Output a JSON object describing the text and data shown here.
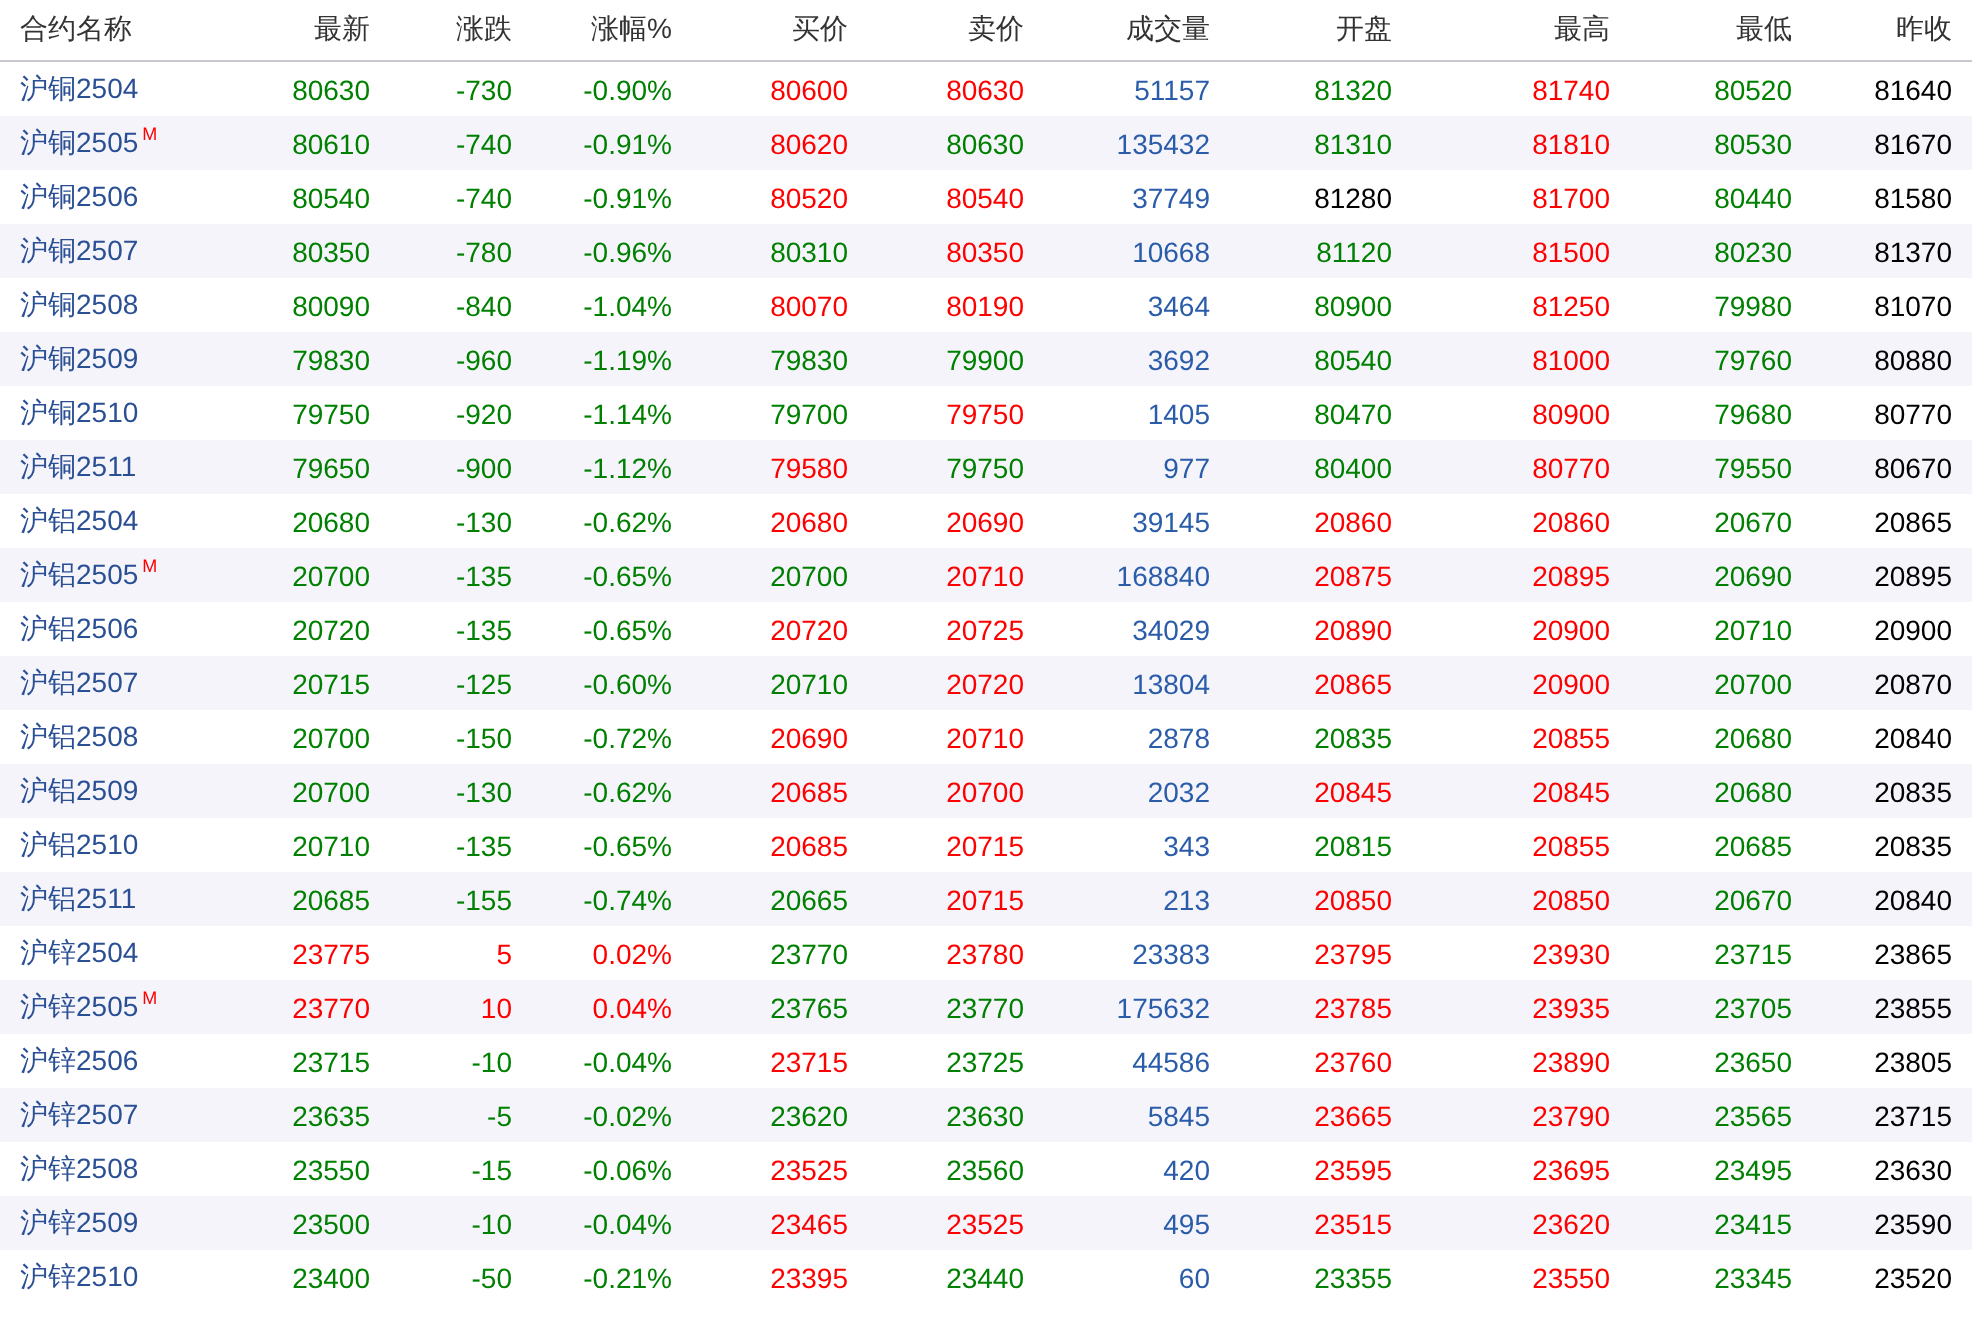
{
  "table": {
    "columns": [
      "合约名称",
      "最新",
      "涨跌",
      "涨幅%",
      "买价",
      "卖价",
      "成交量",
      "开盘",
      "最高",
      "最低",
      "昨收"
    ],
    "rows": [
      {
        "cells": [
          {
            "text": "沪铜2504"
          },
          {
            "text": "80630",
            "color": "#008000"
          },
          {
            "text": "-730",
            "color": "#008000"
          },
          {
            "text": "-0.90%",
            "color": "#008000"
          },
          {
            "text": "80600",
            "color": "#ff0000"
          },
          {
            "text": "80630",
            "color": "#ff0000"
          },
          {
            "text": "51157",
            "color": "#2a5caa"
          },
          {
            "text": "81320",
            "color": "#008000"
          },
          {
            "text": "81740",
            "color": "#ff0000"
          },
          {
            "text": "80520",
            "color": "#008000"
          },
          {
            "text": "81640",
            "color": "#000000"
          }
        ]
      },
      {
        "cells": [
          {
            "text": "沪铜2505",
            "badge": "M"
          },
          {
            "text": "80610",
            "color": "#008000"
          },
          {
            "text": "-740",
            "color": "#008000"
          },
          {
            "text": "-0.91%",
            "color": "#008000"
          },
          {
            "text": "80620",
            "color": "#ff0000"
          },
          {
            "text": "80630",
            "color": "#008000"
          },
          {
            "text": "135432",
            "color": "#2a5caa"
          },
          {
            "text": "81310",
            "color": "#008000"
          },
          {
            "text": "81810",
            "color": "#ff0000"
          },
          {
            "text": "80530",
            "color": "#008000"
          },
          {
            "text": "81670",
            "color": "#000000"
          }
        ]
      },
      {
        "cells": [
          {
            "text": "沪铜2506"
          },
          {
            "text": "80540",
            "color": "#008000"
          },
          {
            "text": "-740",
            "color": "#008000"
          },
          {
            "text": "-0.91%",
            "color": "#008000"
          },
          {
            "text": "80520",
            "color": "#ff0000"
          },
          {
            "text": "80540",
            "color": "#ff0000"
          },
          {
            "text": "37749",
            "color": "#2a5caa"
          },
          {
            "text": "81280",
            "color": "#000000"
          },
          {
            "text": "81700",
            "color": "#ff0000"
          },
          {
            "text": "80440",
            "color": "#008000"
          },
          {
            "text": "81580",
            "color": "#000000"
          }
        ]
      },
      {
        "cells": [
          {
            "text": "沪铜2507"
          },
          {
            "text": "80350",
            "color": "#008000"
          },
          {
            "text": "-780",
            "color": "#008000"
          },
          {
            "text": "-0.96%",
            "color": "#008000"
          },
          {
            "text": "80310",
            "color": "#008000"
          },
          {
            "text": "80350",
            "color": "#ff0000"
          },
          {
            "text": "10668",
            "color": "#2a5caa"
          },
          {
            "text": "81120",
            "color": "#008000"
          },
          {
            "text": "81500",
            "color": "#ff0000"
          },
          {
            "text": "80230",
            "color": "#008000"
          },
          {
            "text": "81370",
            "color": "#000000"
          }
        ]
      },
      {
        "cells": [
          {
            "text": "沪铜2508"
          },
          {
            "text": "80090",
            "color": "#008000"
          },
          {
            "text": "-840",
            "color": "#008000"
          },
          {
            "text": "-1.04%",
            "color": "#008000"
          },
          {
            "text": "80070",
            "color": "#ff0000"
          },
          {
            "text": "80190",
            "color": "#ff0000"
          },
          {
            "text": "3464",
            "color": "#2a5caa"
          },
          {
            "text": "80900",
            "color": "#008000"
          },
          {
            "text": "81250",
            "color": "#ff0000"
          },
          {
            "text": "79980",
            "color": "#008000"
          },
          {
            "text": "81070",
            "color": "#000000"
          }
        ]
      },
      {
        "cells": [
          {
            "text": "沪铜2509"
          },
          {
            "text": "79830",
            "color": "#008000"
          },
          {
            "text": "-960",
            "color": "#008000"
          },
          {
            "text": "-1.19%",
            "color": "#008000"
          },
          {
            "text": "79830",
            "color": "#008000"
          },
          {
            "text": "79900",
            "color": "#008000"
          },
          {
            "text": "3692",
            "color": "#2a5caa"
          },
          {
            "text": "80540",
            "color": "#008000"
          },
          {
            "text": "81000",
            "color": "#ff0000"
          },
          {
            "text": "79760",
            "color": "#008000"
          },
          {
            "text": "80880",
            "color": "#000000"
          }
        ]
      },
      {
        "cells": [
          {
            "text": "沪铜2510"
          },
          {
            "text": "79750",
            "color": "#008000"
          },
          {
            "text": "-920",
            "color": "#008000"
          },
          {
            "text": "-1.14%",
            "color": "#008000"
          },
          {
            "text": "79700",
            "color": "#008000"
          },
          {
            "text": "79750",
            "color": "#ff0000"
          },
          {
            "text": "1405",
            "color": "#2a5caa"
          },
          {
            "text": "80470",
            "color": "#008000"
          },
          {
            "text": "80900",
            "color": "#ff0000"
          },
          {
            "text": "79680",
            "color": "#008000"
          },
          {
            "text": "80770",
            "color": "#000000"
          }
        ]
      },
      {
        "cells": [
          {
            "text": "沪铜2511"
          },
          {
            "text": "79650",
            "color": "#008000"
          },
          {
            "text": "-900",
            "color": "#008000"
          },
          {
            "text": "-1.12%",
            "color": "#008000"
          },
          {
            "text": "79580",
            "color": "#ff0000"
          },
          {
            "text": "79750",
            "color": "#008000"
          },
          {
            "text": "977",
            "color": "#2a5caa"
          },
          {
            "text": "80400",
            "color": "#008000"
          },
          {
            "text": "80770",
            "color": "#ff0000"
          },
          {
            "text": "79550",
            "color": "#008000"
          },
          {
            "text": "80670",
            "color": "#000000"
          }
        ]
      },
      {
        "cells": [
          {
            "text": "沪铝2504"
          },
          {
            "text": "20680",
            "color": "#008000"
          },
          {
            "text": "-130",
            "color": "#008000"
          },
          {
            "text": "-0.62%",
            "color": "#008000"
          },
          {
            "text": "20680",
            "color": "#ff0000"
          },
          {
            "text": "20690",
            "color": "#ff0000"
          },
          {
            "text": "39145",
            "color": "#2a5caa"
          },
          {
            "text": "20860",
            "color": "#ff0000"
          },
          {
            "text": "20860",
            "color": "#ff0000"
          },
          {
            "text": "20670",
            "color": "#008000"
          },
          {
            "text": "20865",
            "color": "#000000"
          }
        ]
      },
      {
        "cells": [
          {
            "text": "沪铝2505",
            "badge": "M"
          },
          {
            "text": "20700",
            "color": "#008000"
          },
          {
            "text": "-135",
            "color": "#008000"
          },
          {
            "text": "-0.65%",
            "color": "#008000"
          },
          {
            "text": "20700",
            "color": "#008000"
          },
          {
            "text": "20710",
            "color": "#ff0000"
          },
          {
            "text": "168840",
            "color": "#2a5caa"
          },
          {
            "text": "20875",
            "color": "#ff0000"
          },
          {
            "text": "20895",
            "color": "#ff0000"
          },
          {
            "text": "20690",
            "color": "#008000"
          },
          {
            "text": "20895",
            "color": "#000000"
          }
        ]
      },
      {
        "cells": [
          {
            "text": "沪铝2506"
          },
          {
            "text": "20720",
            "color": "#008000"
          },
          {
            "text": "-135",
            "color": "#008000"
          },
          {
            "text": "-0.65%",
            "color": "#008000"
          },
          {
            "text": "20720",
            "color": "#ff0000"
          },
          {
            "text": "20725",
            "color": "#ff0000"
          },
          {
            "text": "34029",
            "color": "#2a5caa"
          },
          {
            "text": "20890",
            "color": "#ff0000"
          },
          {
            "text": "20900",
            "color": "#ff0000"
          },
          {
            "text": "20710",
            "color": "#008000"
          },
          {
            "text": "20900",
            "color": "#000000"
          }
        ]
      },
      {
        "cells": [
          {
            "text": "沪铝2507"
          },
          {
            "text": "20715",
            "color": "#008000"
          },
          {
            "text": "-125",
            "color": "#008000"
          },
          {
            "text": "-0.60%",
            "color": "#008000"
          },
          {
            "text": "20710",
            "color": "#008000"
          },
          {
            "text": "20720",
            "color": "#ff0000"
          },
          {
            "text": "13804",
            "color": "#2a5caa"
          },
          {
            "text": "20865",
            "color": "#ff0000"
          },
          {
            "text": "20900",
            "color": "#ff0000"
          },
          {
            "text": "20700",
            "color": "#008000"
          },
          {
            "text": "20870",
            "color": "#000000"
          }
        ]
      },
      {
        "cells": [
          {
            "text": "沪铝2508"
          },
          {
            "text": "20700",
            "color": "#008000"
          },
          {
            "text": "-150",
            "color": "#008000"
          },
          {
            "text": "-0.72%",
            "color": "#008000"
          },
          {
            "text": "20690",
            "color": "#ff0000"
          },
          {
            "text": "20710",
            "color": "#ff0000"
          },
          {
            "text": "2878",
            "color": "#2a5caa"
          },
          {
            "text": "20835",
            "color": "#008000"
          },
          {
            "text": "20855",
            "color": "#ff0000"
          },
          {
            "text": "20680",
            "color": "#008000"
          },
          {
            "text": "20840",
            "color": "#000000"
          }
        ]
      },
      {
        "cells": [
          {
            "text": "沪铝2509"
          },
          {
            "text": "20700",
            "color": "#008000"
          },
          {
            "text": "-130",
            "color": "#008000"
          },
          {
            "text": "-0.62%",
            "color": "#008000"
          },
          {
            "text": "20685",
            "color": "#ff0000"
          },
          {
            "text": "20700",
            "color": "#ff0000"
          },
          {
            "text": "2032",
            "color": "#2a5caa"
          },
          {
            "text": "20845",
            "color": "#ff0000"
          },
          {
            "text": "20845",
            "color": "#ff0000"
          },
          {
            "text": "20680",
            "color": "#008000"
          },
          {
            "text": "20835",
            "color": "#000000"
          }
        ]
      },
      {
        "cells": [
          {
            "text": "沪铝2510"
          },
          {
            "text": "20710",
            "color": "#008000"
          },
          {
            "text": "-135",
            "color": "#008000"
          },
          {
            "text": "-0.65%",
            "color": "#008000"
          },
          {
            "text": "20685",
            "color": "#ff0000"
          },
          {
            "text": "20715",
            "color": "#ff0000"
          },
          {
            "text": "343",
            "color": "#2a5caa"
          },
          {
            "text": "20815",
            "color": "#008000"
          },
          {
            "text": "20855",
            "color": "#ff0000"
          },
          {
            "text": "20685",
            "color": "#008000"
          },
          {
            "text": "20835",
            "color": "#000000"
          }
        ]
      },
      {
        "cells": [
          {
            "text": "沪铝2511"
          },
          {
            "text": "20685",
            "color": "#008000"
          },
          {
            "text": "-155",
            "color": "#008000"
          },
          {
            "text": "-0.74%",
            "color": "#008000"
          },
          {
            "text": "20665",
            "color": "#008000"
          },
          {
            "text": "20715",
            "color": "#ff0000"
          },
          {
            "text": "213",
            "color": "#2a5caa"
          },
          {
            "text": "20850",
            "color": "#ff0000"
          },
          {
            "text": "20850",
            "color": "#ff0000"
          },
          {
            "text": "20670",
            "color": "#008000"
          },
          {
            "text": "20840",
            "color": "#000000"
          }
        ]
      },
      {
        "cells": [
          {
            "text": "沪锌2504"
          },
          {
            "text": "23775",
            "color": "#ff0000"
          },
          {
            "text": "5",
            "color": "#ff0000"
          },
          {
            "text": "0.02%",
            "color": "#ff0000"
          },
          {
            "text": "23770",
            "color": "#008000"
          },
          {
            "text": "23780",
            "color": "#ff0000"
          },
          {
            "text": "23383",
            "color": "#2a5caa"
          },
          {
            "text": "23795",
            "color": "#ff0000"
          },
          {
            "text": "23930",
            "color": "#ff0000"
          },
          {
            "text": "23715",
            "color": "#008000"
          },
          {
            "text": "23865",
            "color": "#000000"
          }
        ]
      },
      {
        "cells": [
          {
            "text": "沪锌2505",
            "badge": "M"
          },
          {
            "text": "23770",
            "color": "#ff0000"
          },
          {
            "text": "10",
            "color": "#ff0000"
          },
          {
            "text": "0.04%",
            "color": "#ff0000"
          },
          {
            "text": "23765",
            "color": "#008000"
          },
          {
            "text": "23770",
            "color": "#008000"
          },
          {
            "text": "175632",
            "color": "#2a5caa"
          },
          {
            "text": "23785",
            "color": "#ff0000"
          },
          {
            "text": "23935",
            "color": "#ff0000"
          },
          {
            "text": "23705",
            "color": "#008000"
          },
          {
            "text": "23855",
            "color": "#000000"
          }
        ]
      },
      {
        "cells": [
          {
            "text": "沪锌2506"
          },
          {
            "text": "23715",
            "color": "#008000"
          },
          {
            "text": "-10",
            "color": "#008000"
          },
          {
            "text": "-0.04%",
            "color": "#008000"
          },
          {
            "text": "23715",
            "color": "#ff0000"
          },
          {
            "text": "23725",
            "color": "#008000"
          },
          {
            "text": "44586",
            "color": "#2a5caa"
          },
          {
            "text": "23760",
            "color": "#ff0000"
          },
          {
            "text": "23890",
            "color": "#ff0000"
          },
          {
            "text": "23650",
            "color": "#008000"
          },
          {
            "text": "23805",
            "color": "#000000"
          }
        ]
      },
      {
        "cells": [
          {
            "text": "沪锌2507"
          },
          {
            "text": "23635",
            "color": "#008000"
          },
          {
            "text": "-5",
            "color": "#008000"
          },
          {
            "text": "-0.02%",
            "color": "#008000"
          },
          {
            "text": "23620",
            "color": "#008000"
          },
          {
            "text": "23630",
            "color": "#008000"
          },
          {
            "text": "5845",
            "color": "#2a5caa"
          },
          {
            "text": "23665",
            "color": "#ff0000"
          },
          {
            "text": "23790",
            "color": "#ff0000"
          },
          {
            "text": "23565",
            "color": "#008000"
          },
          {
            "text": "23715",
            "color": "#000000"
          }
        ]
      },
      {
        "cells": [
          {
            "text": "沪锌2508"
          },
          {
            "text": "23550",
            "color": "#008000"
          },
          {
            "text": "-15",
            "color": "#008000"
          },
          {
            "text": "-0.06%",
            "color": "#008000"
          },
          {
            "text": "23525",
            "color": "#ff0000"
          },
          {
            "text": "23560",
            "color": "#008000"
          },
          {
            "text": "420",
            "color": "#2a5caa"
          },
          {
            "text": "23595",
            "color": "#ff0000"
          },
          {
            "text": "23695",
            "color": "#ff0000"
          },
          {
            "text": "23495",
            "color": "#008000"
          },
          {
            "text": "23630",
            "color": "#000000"
          }
        ]
      },
      {
        "cells": [
          {
            "text": "沪锌2509"
          },
          {
            "text": "23500",
            "color": "#008000"
          },
          {
            "text": "-10",
            "color": "#008000"
          },
          {
            "text": "-0.04%",
            "color": "#008000"
          },
          {
            "text": "23465",
            "color": "#ff0000"
          },
          {
            "text": "23525",
            "color": "#ff0000"
          },
          {
            "text": "495",
            "color": "#2a5caa"
          },
          {
            "text": "23515",
            "color": "#ff0000"
          },
          {
            "text": "23620",
            "color": "#ff0000"
          },
          {
            "text": "23415",
            "color": "#008000"
          },
          {
            "text": "23590",
            "color": "#000000"
          }
        ]
      },
      {
        "cells": [
          {
            "text": "沪锌2510"
          },
          {
            "text": "23400",
            "color": "#008000"
          },
          {
            "text": "-50",
            "color": "#008000"
          },
          {
            "text": "-0.21%",
            "color": "#008000"
          },
          {
            "text": "23395",
            "color": "#ff0000"
          },
          {
            "text": "23440",
            "color": "#008000"
          },
          {
            "text": "60",
            "color": "#2a5caa"
          },
          {
            "text": "23355",
            "color": "#008000"
          },
          {
            "text": "23550",
            "color": "#ff0000"
          },
          {
            "text": "23345",
            "color": "#008000"
          },
          {
            "text": "23520",
            "color": "#000000"
          }
        ]
      }
    ]
  }
}
